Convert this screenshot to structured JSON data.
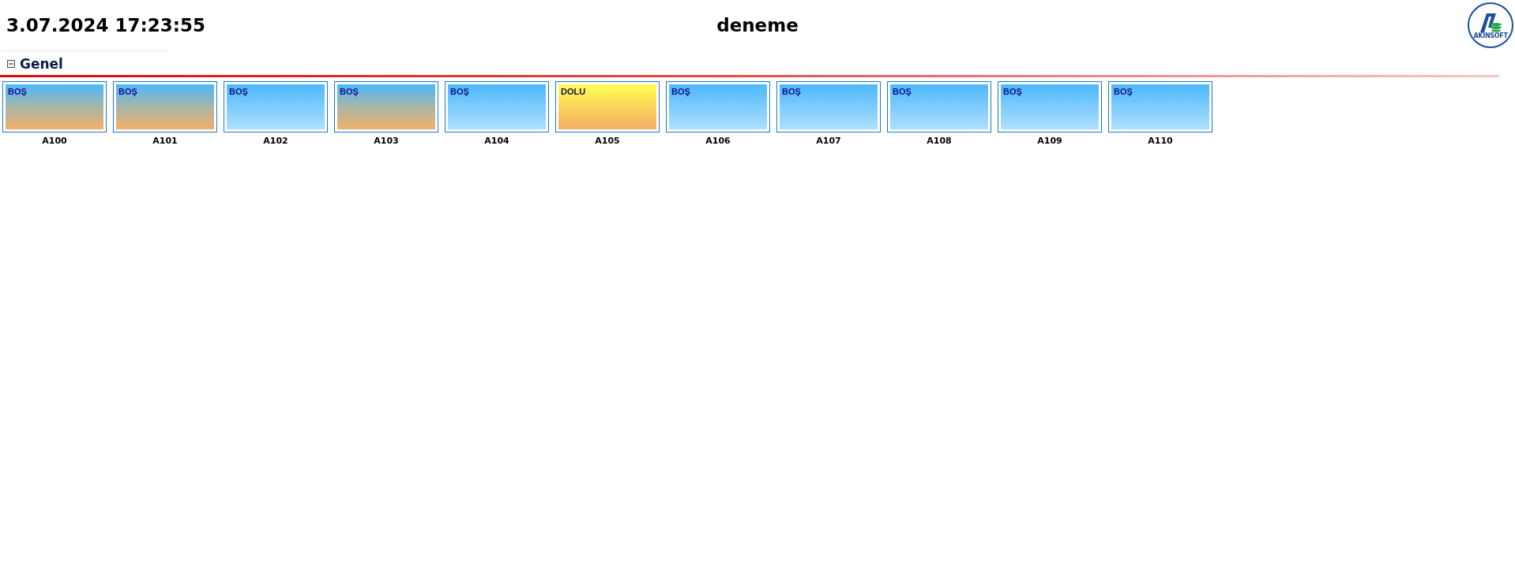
{
  "header": {
    "datetime": "3.07.2024 17:23:55",
    "title": "deneme",
    "logo_text": "AKINSOFT"
  },
  "section": {
    "title": "Genel",
    "expanded": true
  },
  "rooms": [
    {
      "name": "A100",
      "status": "BOŞ",
      "kind": "dirty"
    },
    {
      "name": "A101",
      "status": "BOŞ",
      "kind": "dirty"
    },
    {
      "name": "A102",
      "status": "BOŞ",
      "kind": "clean"
    },
    {
      "name": "A103",
      "status": "BOŞ",
      "kind": "dirty"
    },
    {
      "name": "A104",
      "status": "BOŞ",
      "kind": "clean"
    },
    {
      "name": "A105",
      "status": "DOLU",
      "kind": "occupied"
    },
    {
      "name": "A106",
      "status": "BOŞ",
      "kind": "clean"
    },
    {
      "name": "A107",
      "status": "BOŞ",
      "kind": "clean"
    },
    {
      "name": "A108",
      "status": "BOŞ",
      "kind": "clean"
    },
    {
      "name": "A109",
      "status": "BOŞ",
      "kind": "clean"
    },
    {
      "name": "A110",
      "status": "BOŞ",
      "kind": "clean"
    }
  ]
}
